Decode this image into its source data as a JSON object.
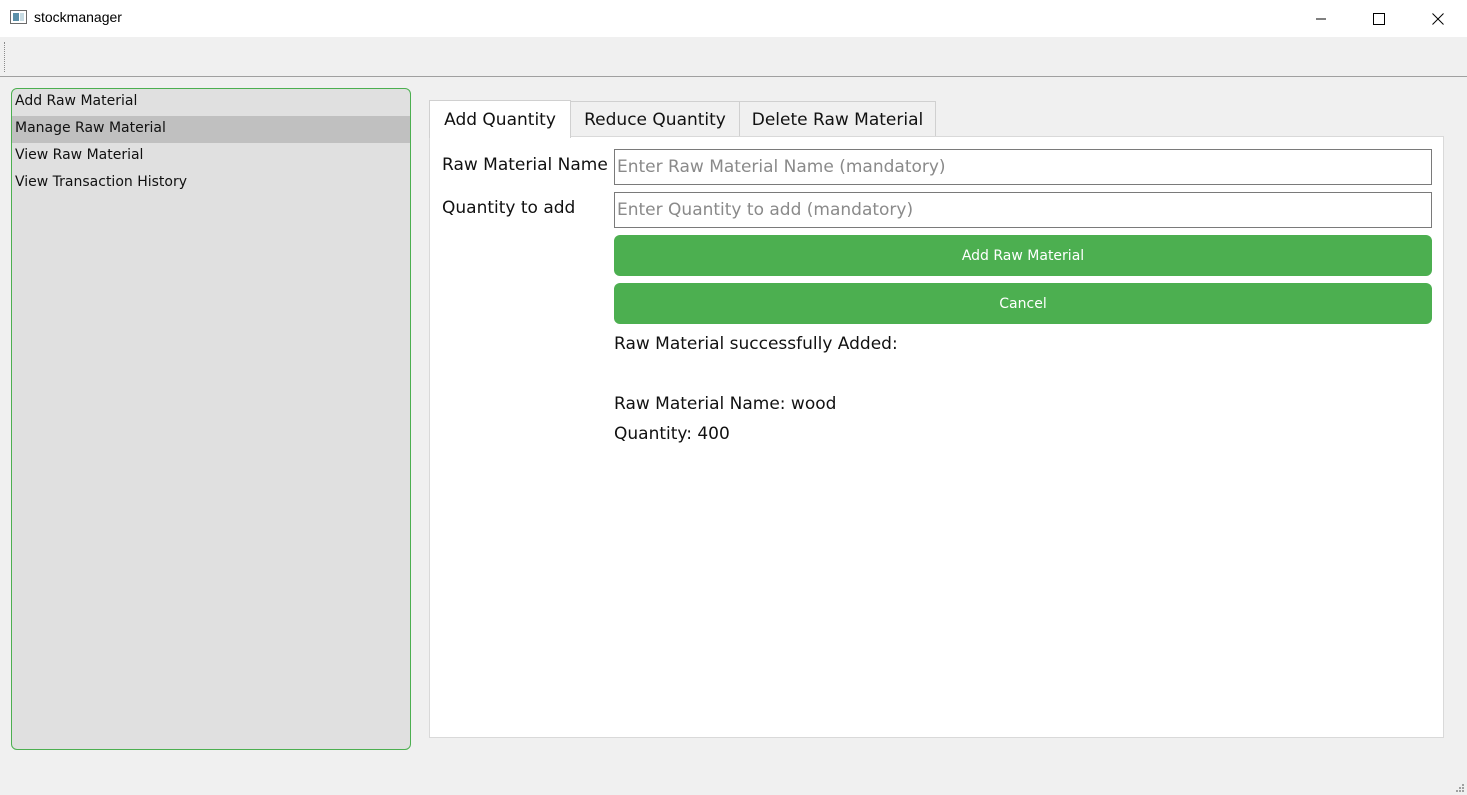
{
  "window": {
    "title": "stockmanager"
  },
  "sidebar": {
    "items": [
      {
        "label": "Add Raw Material",
        "selected": false
      },
      {
        "label": "Manage Raw Material",
        "selected": true
      },
      {
        "label": "View Raw Material",
        "selected": false
      },
      {
        "label": "View Transaction History",
        "selected": false
      }
    ]
  },
  "tabs": [
    {
      "label": "Add Quantity",
      "active": true
    },
    {
      "label": "Reduce Quantity",
      "active": false
    },
    {
      "label": "Delete Raw Material",
      "active": false
    }
  ],
  "form": {
    "name_label": "Raw Material Name",
    "name_placeholder": "Enter Raw Material Name (mandatory)",
    "name_value": "",
    "quantity_label": "Quantity to add",
    "quantity_placeholder": "Enter Quantity to add (mandatory)",
    "quantity_value": "",
    "submit_label": "Add Raw Material",
    "cancel_label": "Cancel"
  },
  "status": {
    "heading": "Raw Material successfully Added:",
    "name_line": "Raw Material Name: wood",
    "quantity_line": "Quantity: 400"
  },
  "colors": {
    "accent": "#4caf50",
    "sidebar_bg": "#e0e0e0",
    "selected_bg": "#c0c0c0"
  }
}
